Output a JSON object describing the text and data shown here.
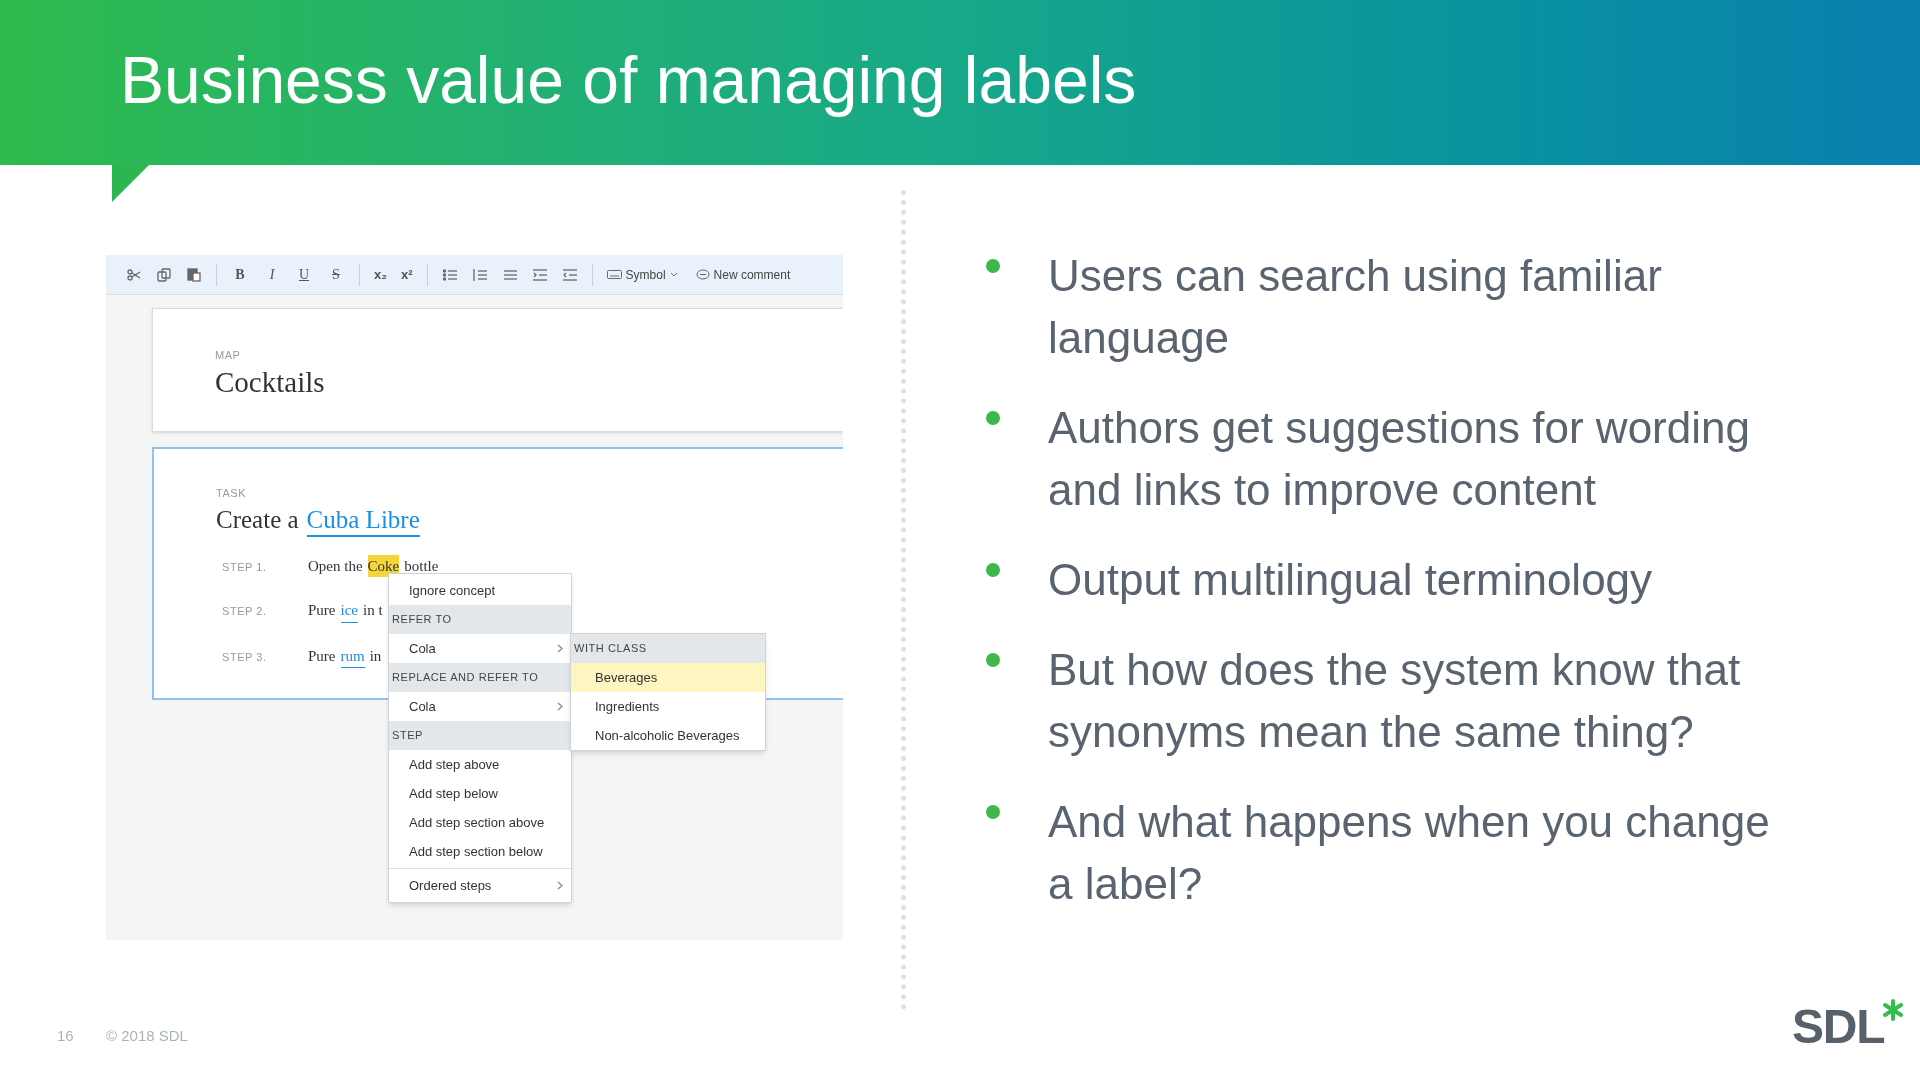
{
  "slide": {
    "title": "Business value of managing labels"
  },
  "editor": {
    "toolbar": {
      "format_buttons": [
        "B",
        "I",
        "U",
        "S"
      ],
      "script_buttons": [
        "x₂",
        "x²"
      ],
      "symbol_button": "Symbol",
      "comment_button": "New comment"
    },
    "map": {
      "label": "MAP",
      "title": "Cocktails"
    },
    "task": {
      "label": "TASK",
      "title_prefix": "Create a",
      "title_link": "Cuba Libre",
      "steps": [
        {
          "label": "STEP 1.",
          "before": "Open the",
          "term": "Coke",
          "kind": "highlight",
          "after": "bottle"
        },
        {
          "label": "STEP 2.",
          "before": "Pure",
          "term": "ice",
          "kind": "link",
          "after": "in t"
        },
        {
          "label": "STEP 3.",
          "before": "Pure",
          "term": "rum",
          "kind": "link",
          "after": "in"
        }
      ]
    },
    "context_menu": [
      {
        "kind": "item",
        "label": "Ignore concept"
      },
      {
        "kind": "header",
        "label": "REFER TO"
      },
      {
        "kind": "submenu",
        "label": "Cola"
      },
      {
        "kind": "header",
        "label": "REPLACE AND REFER TO"
      },
      {
        "kind": "submenu",
        "label": "Cola"
      },
      {
        "kind": "header",
        "label": "STEP"
      },
      {
        "kind": "item",
        "label": "Add step above"
      },
      {
        "kind": "item",
        "label": "Add step below"
      },
      {
        "kind": "item",
        "label": "Add step section above"
      },
      {
        "kind": "item",
        "label": "Add step section below"
      },
      {
        "kind": "separator"
      },
      {
        "kind": "submenu",
        "label": "Ordered steps"
      }
    ],
    "submenu": {
      "header": "WITH CLASS",
      "items": [
        {
          "label": "Beverages",
          "selected": true
        },
        {
          "label": "Ingredients",
          "selected": false
        },
        {
          "label": "Non-alcoholic Beverages",
          "selected": false
        }
      ]
    }
  },
  "bullets": [
    "Users can search using familiar language",
    "Authors get suggestions for wording and links to improve content",
    "Output multilingual terminology",
    "But how does the system know that synonyms mean the same thing?",
    "And what happens when you change a label?"
  ],
  "footer": {
    "page_number": "16",
    "copyright": "© 2018 SDL",
    "logo": "SDL"
  }
}
